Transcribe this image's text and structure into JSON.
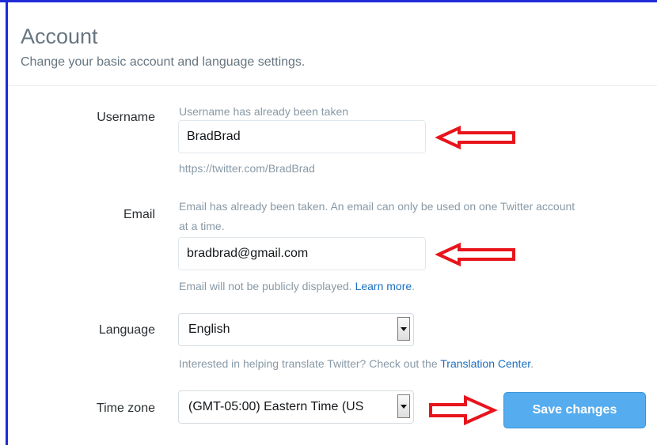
{
  "account": {
    "title": "Account",
    "subtitle": "Change your basic account and language settings."
  },
  "username": {
    "label": "Username",
    "error": "Username has already been taken",
    "value": "BradBrad",
    "url": "https://twitter.com/BradBrad"
  },
  "email": {
    "label": "Email",
    "error_line1": "Email has already been taken. An email can only be used on one Twitter account",
    "error_line2": "at a time.",
    "value": "bradbrad@gmail.com",
    "note": "Email will not be publicly displayed.",
    "learn_more": "Learn more",
    "note_end": "."
  },
  "language": {
    "label": "Language",
    "selected": "English",
    "hint": "Interested in helping translate Twitter? Check out the",
    "hint_link": "Translation Center",
    "hint_end": "."
  },
  "timezone": {
    "label": "Time zone",
    "selected": "(GMT-05:00) Eastern Time (US"
  },
  "actions": {
    "save_label": "Save changes"
  },
  "colors": {
    "primary_button": "#55acee",
    "link": "#1b6fbf",
    "annotation_arrow": "#e8141c",
    "frame": "#1f2bd6"
  }
}
